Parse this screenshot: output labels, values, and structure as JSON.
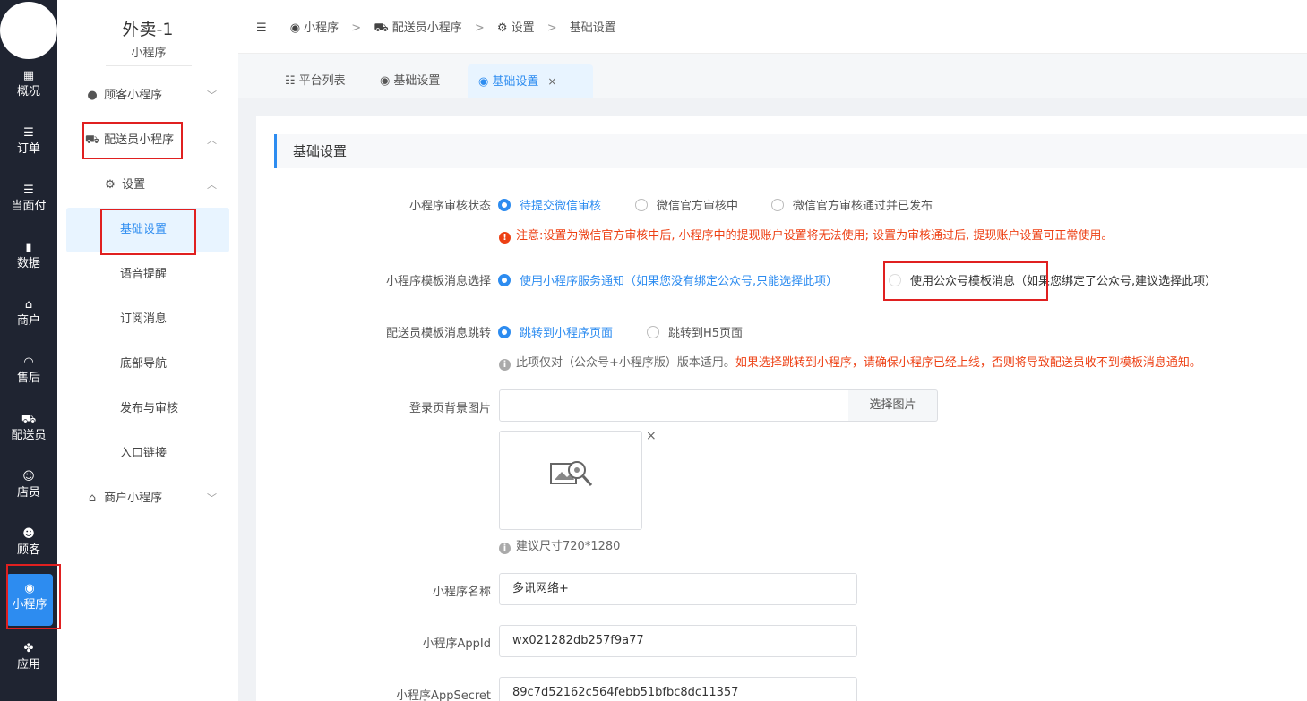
{
  "rail": {
    "items": [
      {
        "icon": "▦",
        "label": "概况"
      },
      {
        "icon": "☰",
        "label": "订单"
      },
      {
        "icon": "☰",
        "label": "当面付"
      },
      {
        "icon": "▮",
        "label": "数据"
      },
      {
        "icon": "⌂",
        "label": "商户"
      },
      {
        "icon": "◠",
        "label": "售后"
      },
      {
        "icon": "⛟",
        "label": "配送员"
      },
      {
        "icon": "☺",
        "label": "店员"
      },
      {
        "icon": "☻",
        "label": "顾客"
      },
      {
        "icon": "◉",
        "label": "小程序"
      },
      {
        "icon": "✤",
        "label": "应用"
      }
    ]
  },
  "sidebar": {
    "title": "外卖-1",
    "subtitle": "小程序",
    "groups": [
      {
        "icon": "●",
        "label": "顾客小程序"
      },
      {
        "icon": "⛟",
        "label": "配送员小程序"
      },
      {
        "icon": "⚙",
        "label": "设置"
      },
      {
        "icon": "⌂",
        "label": "商户小程序"
      }
    ],
    "sub_items": [
      "基础设置",
      "语音提醒",
      "订阅消息",
      "底部导航",
      "发布与审核",
      "入口链接"
    ]
  },
  "breadcrumb": {
    "collapse_icon": "☰",
    "items": [
      {
        "icon": "◉",
        "label": "小程序"
      },
      {
        "icon": "⛟",
        "label": "配送员小程序"
      },
      {
        "icon": "⚙",
        "label": "设置"
      },
      {
        "icon": "",
        "label": "基础设置"
      }
    ],
    "separator": ">"
  },
  "tabs": [
    {
      "icon": "☷",
      "label": "平台列表"
    },
    {
      "icon": "◉",
      "label": "基础设置"
    },
    {
      "icon": "◉",
      "label": "基础设置",
      "close": "×"
    }
  ],
  "section_title": "基础设置",
  "form": {
    "review_status": {
      "label": "小程序审核状态",
      "options": [
        "待提交微信审核",
        "微信官方审核中",
        "微信官方审核通过并已发布"
      ],
      "selected": 0,
      "warning": "注意:设置为微信官方审核中后, 小程序中的提现账户设置将无法使用; 设置为审核通过后, 提现账户设置可正常使用。"
    },
    "template_msg": {
      "label": "小程序模板消息选择",
      "options": [
        "使用小程序服务通知（如果您没有绑定公众号,只能选择此项）",
        "使用公众号模板消息（如果您绑定了公众号,建议选择此项）"
      ],
      "selected": 0
    },
    "jump": {
      "label": "配送员模板消息跳转",
      "options": [
        "跳转到小程序页面",
        "跳转到H5页面"
      ],
      "selected": 0,
      "tip_plain": "此项仅对（公众号+小程序版）版本适用。",
      "tip_red": "如果选择跳转到小程序，请确保小程序已经上线，否则将导致配送员收不到模板消息通知。"
    },
    "bg_image": {
      "label": "登录页背景图片",
      "value": "",
      "button": "选择图片",
      "close": "×",
      "hint": "建议尺寸720*1280"
    },
    "app_name": {
      "label": "小程序名称",
      "value": "多讯网络+"
    },
    "app_id": {
      "label": "小程序AppId",
      "value": "wx021282db257f9a77"
    },
    "app_secret": {
      "label": "小程序AppSecret",
      "value": "89c7d52162c564febb51bfbc8dc11357"
    }
  },
  "colors": {
    "accent": "#2d8cf0",
    "rail_bg": "#1f2431",
    "error": "#ed4014",
    "highlight_box": "#e02020"
  }
}
